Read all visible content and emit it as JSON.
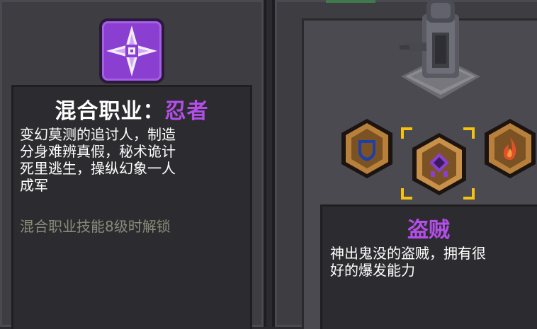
{
  "left_panel": {
    "icon": "ninja-shuriken-icon",
    "title_prefix": "混合职业：",
    "title_class": "忍者",
    "description_lines": [
      "变幻莫测的追讨人，制造",
      "分身难辨真假，秘术诡计",
      "死里逃生，操纵幻象一人",
      "成军"
    ],
    "unlock_text": "混合职业技能8级时解锁"
  },
  "right_panel": {
    "statue": "stone-statue-icon",
    "badges": [
      {
        "icon": "shield-icon",
        "selected": false
      },
      {
        "icon": "rogue-mask-icon",
        "selected": true
      },
      {
        "icon": "fire-icon",
        "selected": false
      }
    ],
    "class_name": "盗贼",
    "class_desc_lines": [
      "神出鬼没的盗贼，拥有很",
      "好的爆发能力"
    ]
  },
  "colors": {
    "accent_purple": "#b44ee8",
    "selector_gold": "#f5c211",
    "unlock_gray": "#8a8a7a"
  }
}
